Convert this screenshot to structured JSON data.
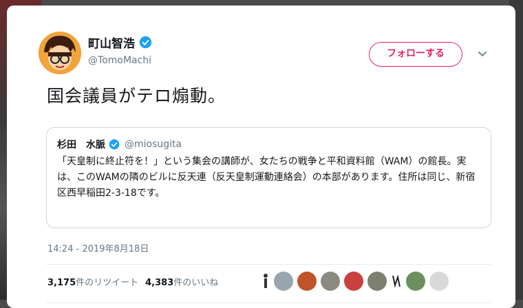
{
  "author": {
    "display_name": "町山智浩",
    "handle": "@TomoMachi"
  },
  "follow_label": "フォローする",
  "tweet_text": "国会議員がテロ煽動。",
  "quoted": {
    "display_name": "杉田　水脈",
    "handle": "@miosugita",
    "body": "「天皇制に終止符を！」という集会の講師が、女たちの戦争と平和資料館（WAM）の館長。実は、このWAMの隣のビルに反天連（反天皇制運動連絡会）の本部があります。住所は同じ、新宿区西早稲田2-3-18です。"
  },
  "timestamp": "14:24 - 2019年8月18日",
  "stats": {
    "retweet_count": "3,175",
    "retweet_label": "件のリツイート",
    "like_count": "4,383",
    "like_label": "件のいいね"
  },
  "colors": {
    "follow": "#e0245e",
    "verified": "#1da1f2"
  },
  "likers": [
    "user-avatar",
    "user-avatar",
    "user-avatar",
    "user-avatar",
    "user-avatar",
    "user-avatar",
    "user-avatar",
    "user-avatar",
    "user-avatar",
    "user-avatar"
  ]
}
